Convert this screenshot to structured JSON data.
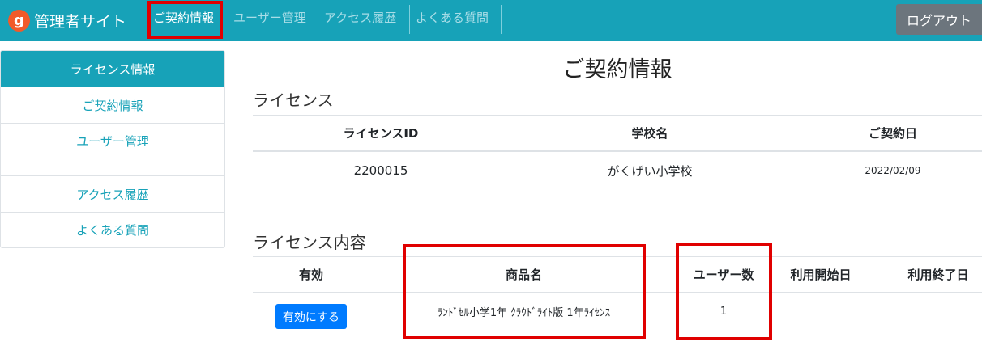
{
  "nav": {
    "brand_logo": "g",
    "brand_title": "管理者サイト",
    "links": [
      {
        "label": "ご契約情報",
        "active": true
      },
      {
        "label": "ユーザー管理",
        "active": false
      },
      {
        "label": "アクセス履歴",
        "active": false
      },
      {
        "label": "よくある質問",
        "active": false
      }
    ],
    "logout_label": "ログアウト"
  },
  "sidebar": {
    "header": "ライセンス情報",
    "items": [
      {
        "label": "ご契約情報"
      },
      {
        "label": "ユーザー管理"
      },
      {
        "label": "アクセス履歴"
      },
      {
        "label": "よくある質問"
      }
    ]
  },
  "main": {
    "title": "ご契約情報",
    "license": {
      "heading": "ライセンス",
      "columns": [
        "ライセンスID",
        "学校名",
        "ご契約日"
      ],
      "row": {
        "id": "2200015",
        "school": "がくげい小学校",
        "date": "2022/02/09"
      }
    },
    "contents": {
      "heading": "ライセンス内容",
      "columns": [
        "有効",
        "商品名",
        "ユーザー数",
        "利用開始日",
        "利用終了日"
      ],
      "row": {
        "enable_button": "有効にする",
        "product": "ﾗﾝﾄﾞｾﾙ小学1年 ｸﾗｳﾄﾞﾗｲﾄ版 1年ﾗｲｾﾝｽ",
        "users": "1",
        "start": "",
        "end": ""
      }
    }
  },
  "colors": {
    "navbar": "#17a2b8",
    "highlight": "#e00000",
    "primary_button": "#007bff",
    "logout_button": "#6c757d"
  }
}
